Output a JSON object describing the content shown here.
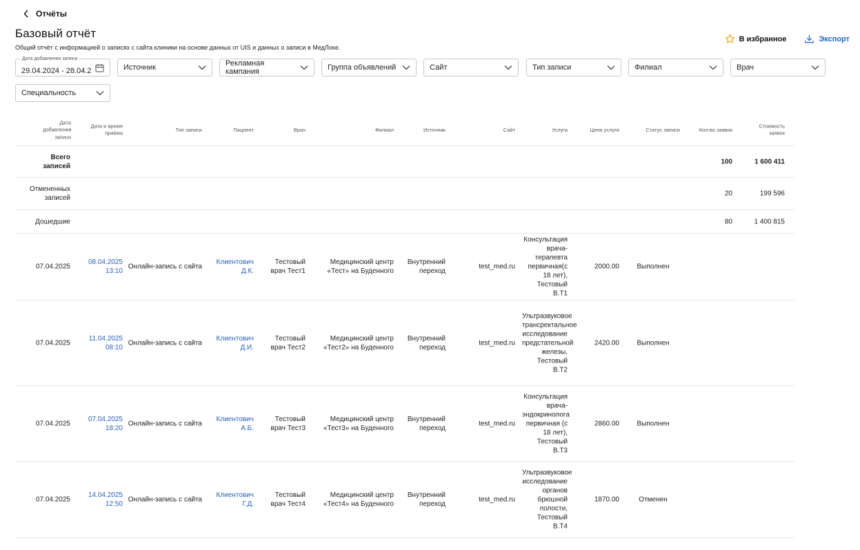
{
  "nav": {
    "back_label": "Отчёты"
  },
  "header": {
    "title": "Базовый отчёт",
    "subtitle": "Общий отчёт с информацией о записях с сайта клиники на основе данных от UIS и данных о записи в МедЛоке.",
    "favorite_label": "В избранное",
    "export_label": "Экспорт"
  },
  "filters": {
    "date": {
      "label": "Дата добавления записи",
      "value": "29.04.2024 - 28.04.2"
    },
    "source": "Источник",
    "campaign": "Рекламная кампания",
    "ad_group": "Группа объявлений",
    "site": "Сайт",
    "record_type": "Тип записи",
    "branch": "Филиал",
    "doctor": "Врач",
    "specialty": "Специальность"
  },
  "table": {
    "columns": {
      "added": "Дата добавления записи",
      "appointment": "Дата и время приёма",
      "type": "Тип записи",
      "patient": "Пациент",
      "doctor": "Врач",
      "branch": "Филиал",
      "source": "Источник",
      "site": "Сайт",
      "service": "Услуга",
      "price": "Цена услуги",
      "status": "Статус записи",
      "count": "Кол-во заявок",
      "cost": "Стоимость заявок"
    },
    "summary": [
      {
        "label": "Всего записей",
        "count": "100",
        "cost": "1 600 411"
      },
      {
        "label": "Отмененных записей",
        "count": "20",
        "cost": "199 596"
      },
      {
        "label": "Дошедшие",
        "count": "80",
        "cost": "1 400 815"
      }
    ],
    "rows": [
      {
        "added": "07.04.2025",
        "appointment": "08.04.2025 13:10",
        "type": "Онлайн-запись с сайта",
        "patient": "Клиентович Д.К.",
        "doctor": "Тестовый врач Тест1",
        "branch": "Медицинский центр «Тест» на Буденного",
        "source": "Внутренний переход",
        "site": "test_med.ru",
        "service": "Консультация врача-терапевта первичная(с 18 лет), Тестовый В.Т1",
        "price": "2000.00",
        "status": "Выполнен"
      },
      {
        "added": "07.04.2025",
        "appointment": "11.04.2025 08:10",
        "type": "Онлайн-запись с сайта",
        "patient": "Клиентович Д.И.",
        "doctor": "Тестовый врач Тест2",
        "branch": "Медицинский центр «Тест2» на Буденного",
        "source": "Внутренний переход",
        "site": "test_med.ru",
        "service": "Ультразвуковое трансректальное исследование предстательной железы, Тестовый В.Т2",
        "price": "2420.00",
        "status": "Выполнен"
      },
      {
        "added": "07.04.2025",
        "appointment": "07.04.2025 18:20",
        "type": "Онлайн-запись с сайта",
        "patient": "Клиентович А.Б.",
        "doctor": "Тестовый врач Тест3",
        "branch": "Медицинский центр «Тест3» на Буденного",
        "source": "Внутренний переход",
        "site": "test_med.ru",
        "service": "Консультация врача-эндокринолога первичная (с 18 лет), Тестовый В.Т3",
        "price": "2860.00",
        "status": "Выполнен"
      },
      {
        "added": "07.04.2025",
        "appointment": "14.04.2025 12:50",
        "type": "Онлайн-запись с сайта",
        "patient": "Клиентович Г.Д.",
        "doctor": "Тестовый врач Тест4",
        "branch": "Медицинский центр «Тест4» на Буденного",
        "source": "Внутренний переход",
        "site": "test_med.ru",
        "service": "Ультразвуковое исследование органов брюшной полости, Тестовый В.Т4",
        "price": "1870.00",
        "status": "Отменен"
      }
    ]
  }
}
